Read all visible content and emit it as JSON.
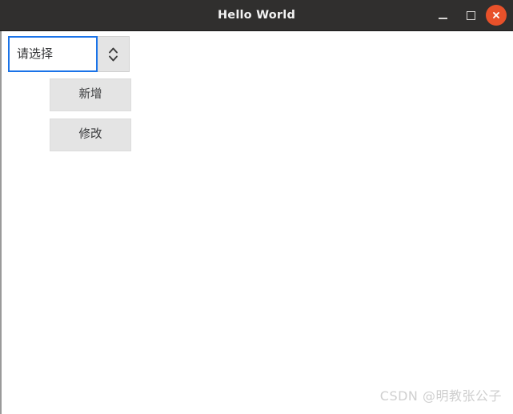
{
  "window": {
    "title": "Hello World",
    "titlebar_bg": "#302f2e",
    "client_bg": "#ffffff",
    "controls": {
      "minimize": {
        "icon": "minimize-icon",
        "label": "–"
      },
      "maximize": {
        "icon": "maximize-icon",
        "label": "□"
      },
      "close": {
        "icon": "close-icon",
        "label": "✕",
        "bg": "#e8512a"
      }
    }
  },
  "form": {
    "combobox": {
      "value": "请选择",
      "placeholder": "请选择",
      "focused": true,
      "focus_color": "#1a73e8",
      "spinner_icon": "up-down-chevron-icon"
    },
    "buttons": [
      {
        "label": "新增",
        "name": "add-button"
      },
      {
        "label": "修改",
        "name": "edit-button"
      }
    ]
  },
  "watermark": {
    "text": "CSDN @明教张公子",
    "color": "#cfcfcf"
  }
}
